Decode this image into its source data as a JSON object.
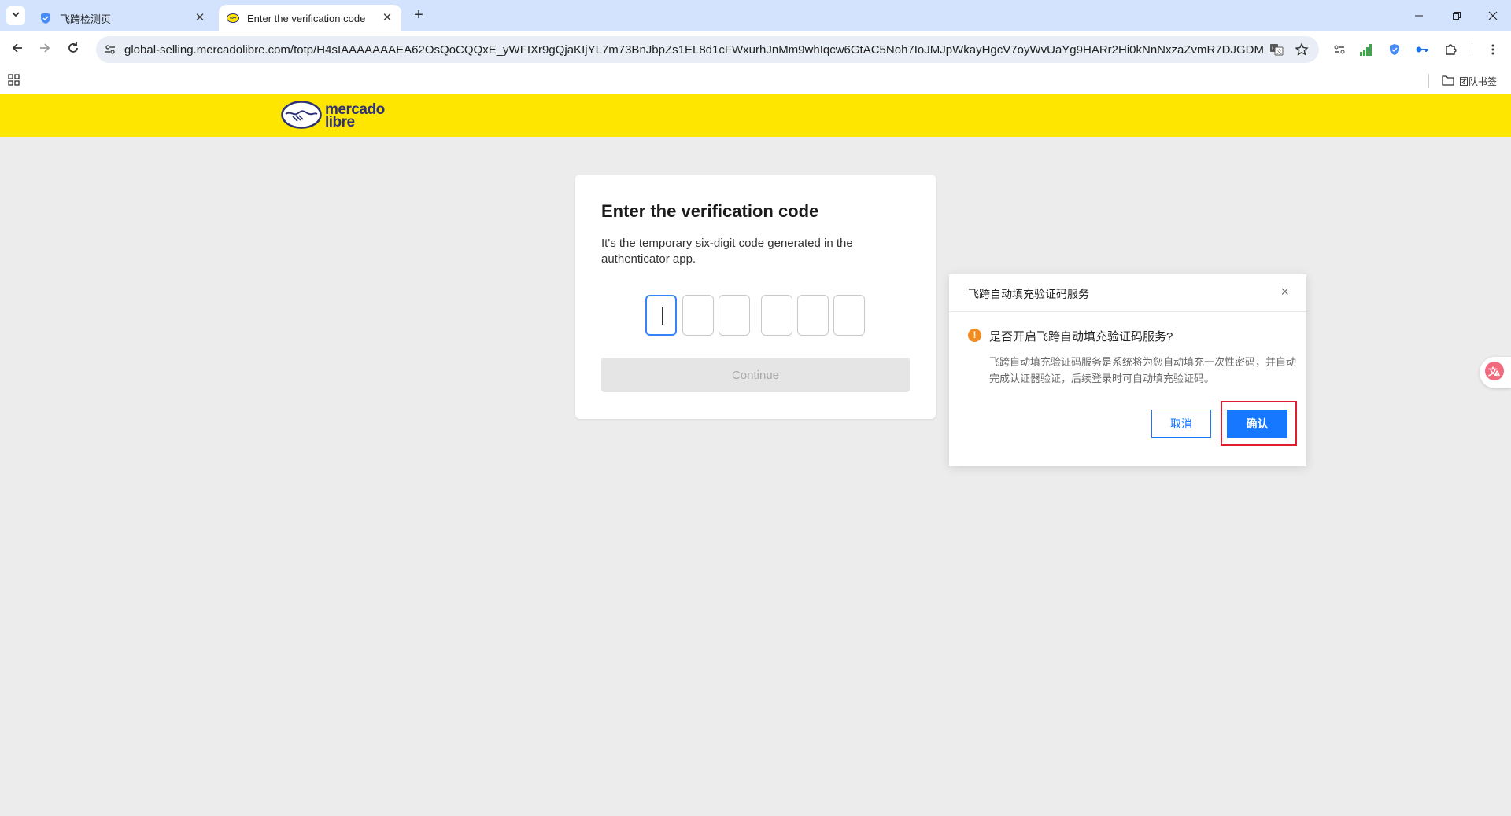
{
  "browser": {
    "tabs": [
      {
        "title": "飞跨检测页",
        "active": false
      },
      {
        "title": "Enter the verification code",
        "active": true
      }
    ],
    "url": "global-selling.mercadolibre.com/totp/H4sIAAAAAAAEA62OsQoCQQxE_yWFIXr9gQjaKIjYL7m73BnJbpZs1EL8d1cFWxurhJnMm9whIqcw6GtAC5Noh7IoJMJpWkayHgcV7oyWvUaYg9HARr2Hi0kNnNxzaZvmR7DJGDM2...",
    "bookmarks_folder": "团队书签"
  },
  "site": {
    "logo_line1": "mercado",
    "logo_line2": "libre",
    "brand_color": "#ffe600"
  },
  "card": {
    "title": "Enter the verification code",
    "description": "It's the temporary six-digit code generated in the authenticator app.",
    "code_digits": [
      "",
      "",
      "",
      "",
      "",
      ""
    ],
    "continue_label": "Continue"
  },
  "dialog": {
    "title": "飞跨自动填充验证码服务",
    "question": "是否开启飞跨自动填充验证码服务?",
    "detail": "飞跨自动填充验证码服务是系统将为您自动填充一次性密码，并自动完成认证器验证，后续登录时可自动填充验证码。",
    "cancel_label": "取消",
    "confirm_label": "确认",
    "accent_color": "#1677ff",
    "highlight_color": "#e01e2e"
  }
}
